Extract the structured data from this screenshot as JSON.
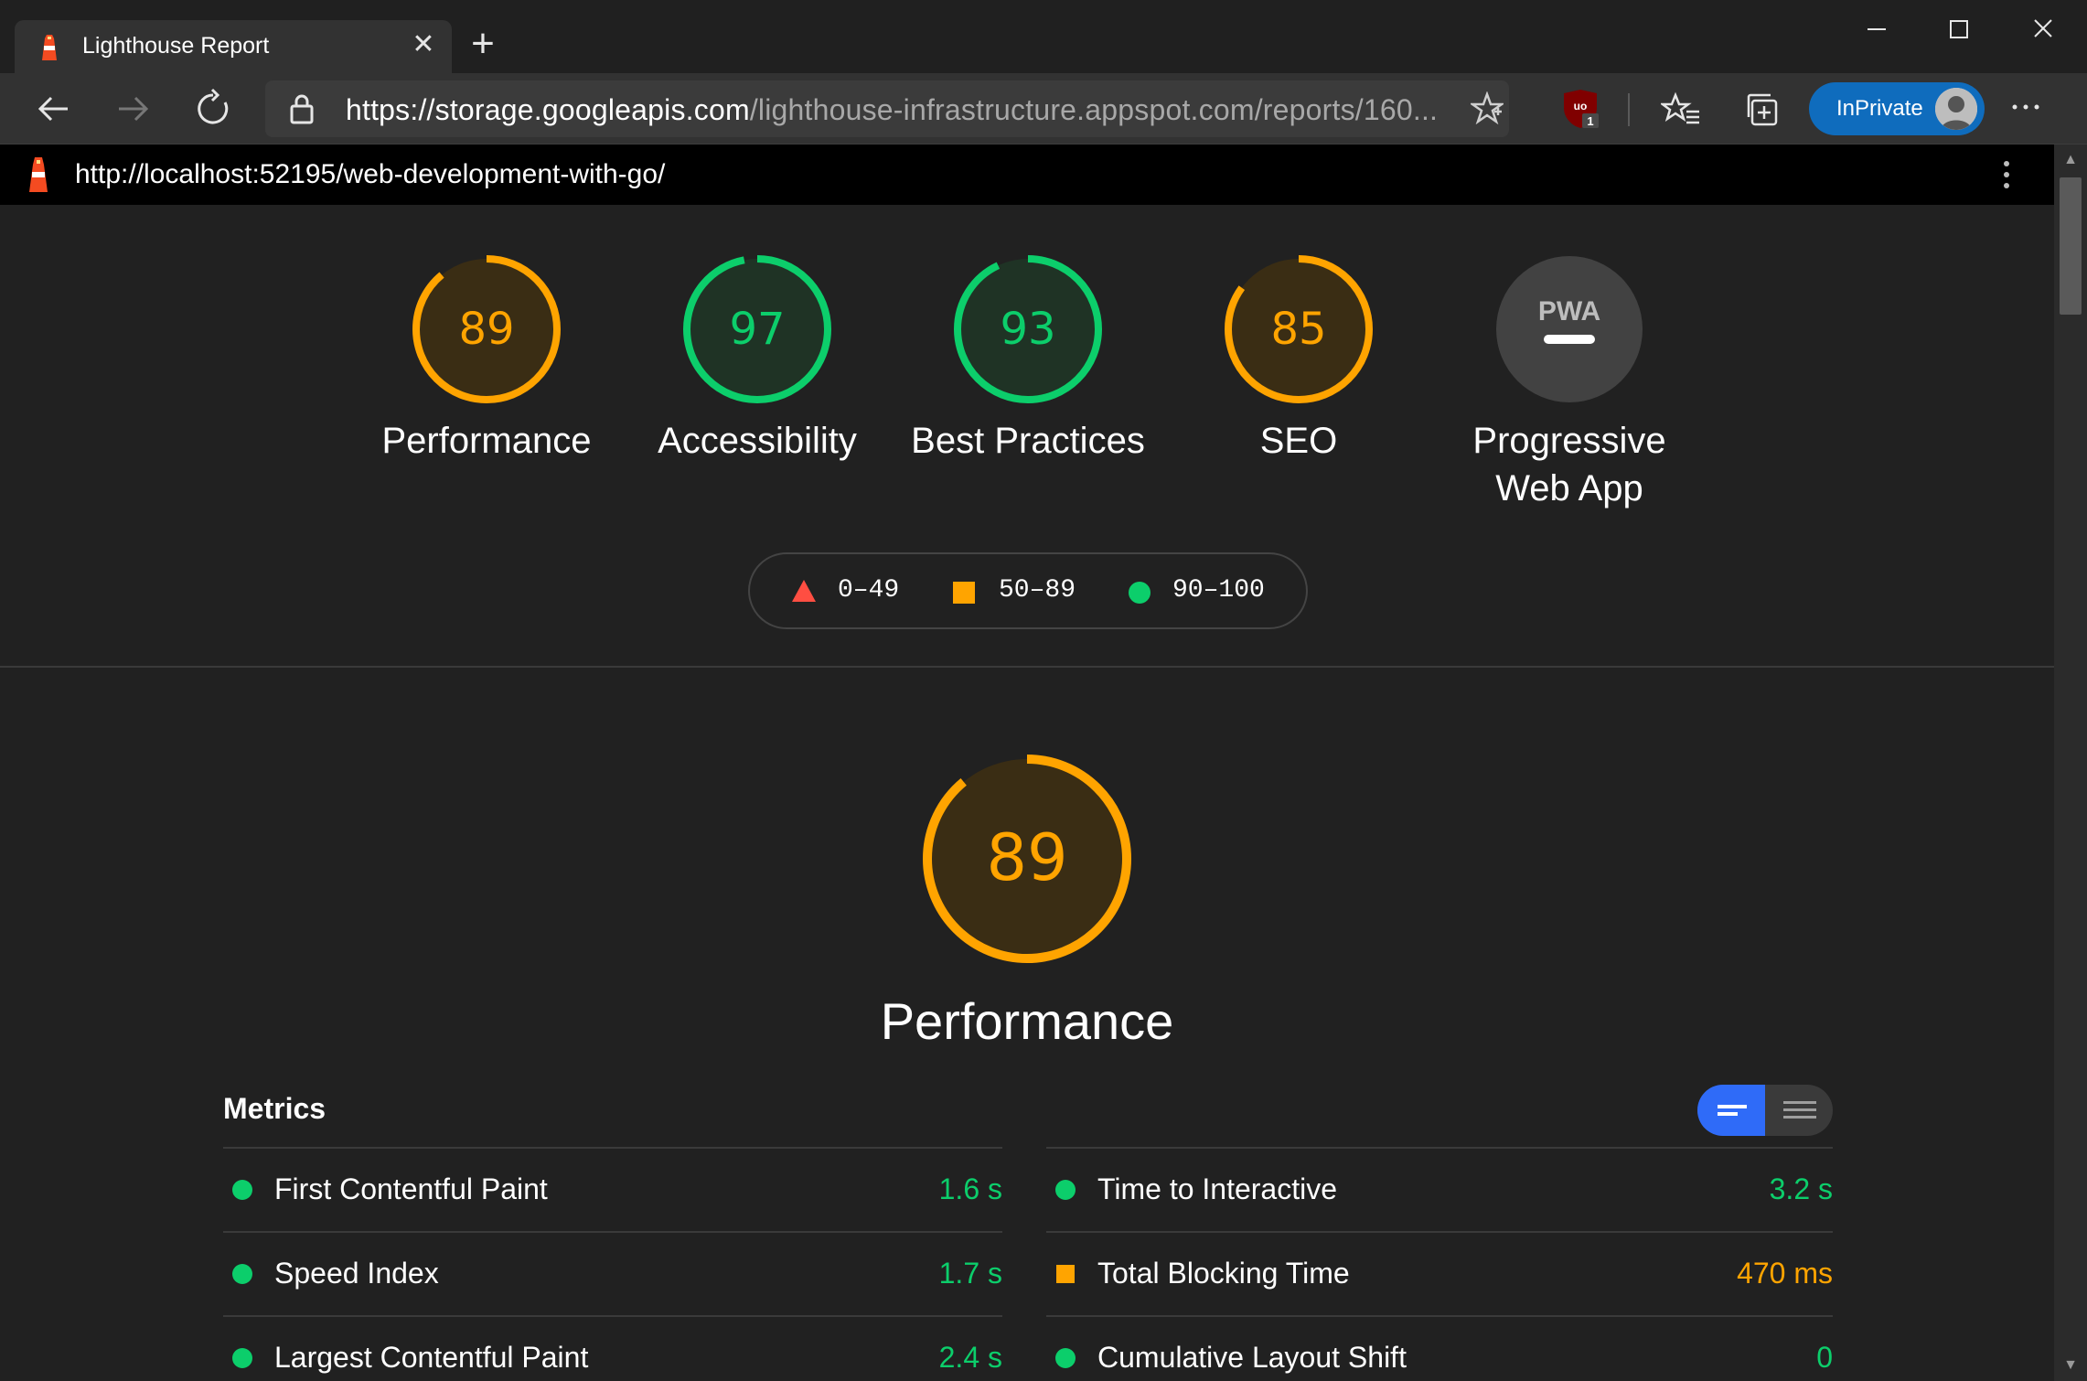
{
  "tab": {
    "title": "Lighthouse Report",
    "close_glyph": "✕",
    "new_tab_glyph": "+"
  },
  "window_controls": {
    "minimize": "—",
    "maximize": "☐",
    "close": "✕"
  },
  "toolbar": {
    "url_host": "https://storage.googleapis.com",
    "url_path": "/lighthouse-infrastructure.appspot.com/reports/160...",
    "inprivate_label": "InPrivate",
    "extension_badge": "1"
  },
  "report": {
    "url": "http://localhost:52195/web-development-with-go/"
  },
  "gauges": [
    {
      "label": "Performance",
      "score": "89",
      "value": 0.89,
      "rating": "average"
    },
    {
      "label": "Accessibility",
      "score": "97",
      "value": 0.97,
      "rating": "pass"
    },
    {
      "label": "Best Practices",
      "score": "93",
      "value": 0.93,
      "rating": "pass"
    },
    {
      "label": "SEO",
      "score": "85",
      "value": 0.85,
      "rating": "average"
    },
    {
      "label": "Progressive Web App",
      "label_line1": "Progressive",
      "label_line2": "Web App",
      "badge": "PWA",
      "rating": "pwa"
    }
  ],
  "legend": [
    {
      "range": "0–49",
      "shape": "triangle",
      "color": "#ff4e42"
    },
    {
      "range": "50–89",
      "shape": "square",
      "color": "#ffa400"
    },
    {
      "range": "90–100",
      "shape": "circle",
      "color": "#0cce6b"
    }
  ],
  "performance": {
    "score": "89",
    "value": 0.89,
    "title": "Performance"
  },
  "metrics": {
    "title": "Metrics",
    "left": [
      {
        "name": "First Contentful Paint",
        "value": "1.6 s",
        "rating": "pass"
      },
      {
        "name": "Speed Index",
        "value": "1.7 s",
        "rating": "pass"
      },
      {
        "name": "Largest Contentful Paint",
        "value": "2.4 s",
        "rating": "pass"
      }
    ],
    "right": [
      {
        "name": "Time to Interactive",
        "value": "3.2 s",
        "rating": "pass"
      },
      {
        "name": "Total Blocking Time",
        "value": "470 ms",
        "rating": "average"
      },
      {
        "name": "Cumulative Layout Shift",
        "value": "0",
        "rating": "pass"
      }
    ]
  },
  "colors": {
    "pass": "#0cce6b",
    "average": "#ffa400",
    "fail": "#ff4e42",
    "pass_bg": "#1f3325",
    "average_bg": "#3a2d14",
    "accent": "#2f6bf8"
  }
}
